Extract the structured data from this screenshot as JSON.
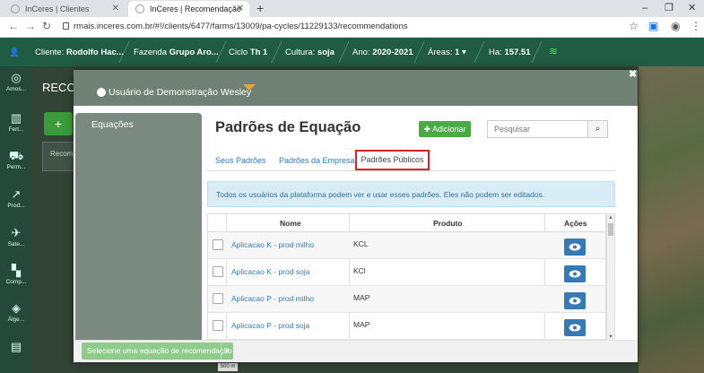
{
  "browser": {
    "tabs": [
      {
        "title": "InCeres | Clientes",
        "active": false
      },
      {
        "title": "InCeres | Recomendação",
        "active": true
      }
    ],
    "url": "rmais.inceres.com.br/#!/clients/6477/farms/13009/pa-cycles/11229133/recommendations"
  },
  "header": {
    "cliente_label": "Cliente:",
    "cliente": "Rodolfo Hac...",
    "fazenda_label": "Fazenda",
    "fazenda": "Grupo Aro...",
    "ciclo_label": "Ciclo",
    "ciclo": "Th 1",
    "cultura_label": "Cultura:",
    "cultura": "soja",
    "ano_label": "Ano:",
    "ano": "2020-2021",
    "areas_label": "Áreas:",
    "areas": "1",
    "ha_label": "Ha:",
    "ha": "157.51"
  },
  "sidebar": {
    "items": [
      {
        "label": "Amos...",
        "icon": "sample-icon"
      },
      {
        "label": "Fert...",
        "icon": "fertility-icon"
      },
      {
        "label": "Perm...",
        "icon": "tractor-icon"
      },
      {
        "label": "Prod...",
        "icon": "chart-icon"
      },
      {
        "label": "Sate...",
        "icon": "satellite-icon"
      },
      {
        "label": "Comp...",
        "icon": "compare-icon"
      },
      {
        "label": "Álge...",
        "icon": "layers-icon"
      }
    ]
  },
  "background": {
    "title": "RECO",
    "card_label": "Recom"
  },
  "modal": {
    "user": "Usuário de Demonstração Wesley",
    "sidebar_label": "Equações",
    "title": "Padrões de Equação",
    "add_label": "Adicionar",
    "search_placeholder": "Pesquisar",
    "tabs": [
      "Seus Padrões",
      "Padrões da Empresa",
      "Padrões Públicos"
    ],
    "info": "Todos os usuários da plataforma podem ver e usar esses padrões. Eles não podem ser editados.",
    "columns": [
      "Nome",
      "Produto",
      "Ações"
    ],
    "rows": [
      {
        "name": "Aplicacao K - prod milho",
        "product": "KCL"
      },
      {
        "name": "Aplicacao K - prod soja",
        "product": "KCl"
      },
      {
        "name": "Aplicacao P - prod milho",
        "product": "MAP"
      },
      {
        "name": "Aplicacao P - prod soja",
        "product": "MAP"
      }
    ],
    "select_label": "Selecione uma equação de recomendação",
    "scale": "500 m"
  },
  "colors": {
    "header_green": "#1f5c43",
    "add_green": "#4aaa45",
    "link_blue": "#2f7bbd",
    "active_tab_border": "#e02020"
  }
}
